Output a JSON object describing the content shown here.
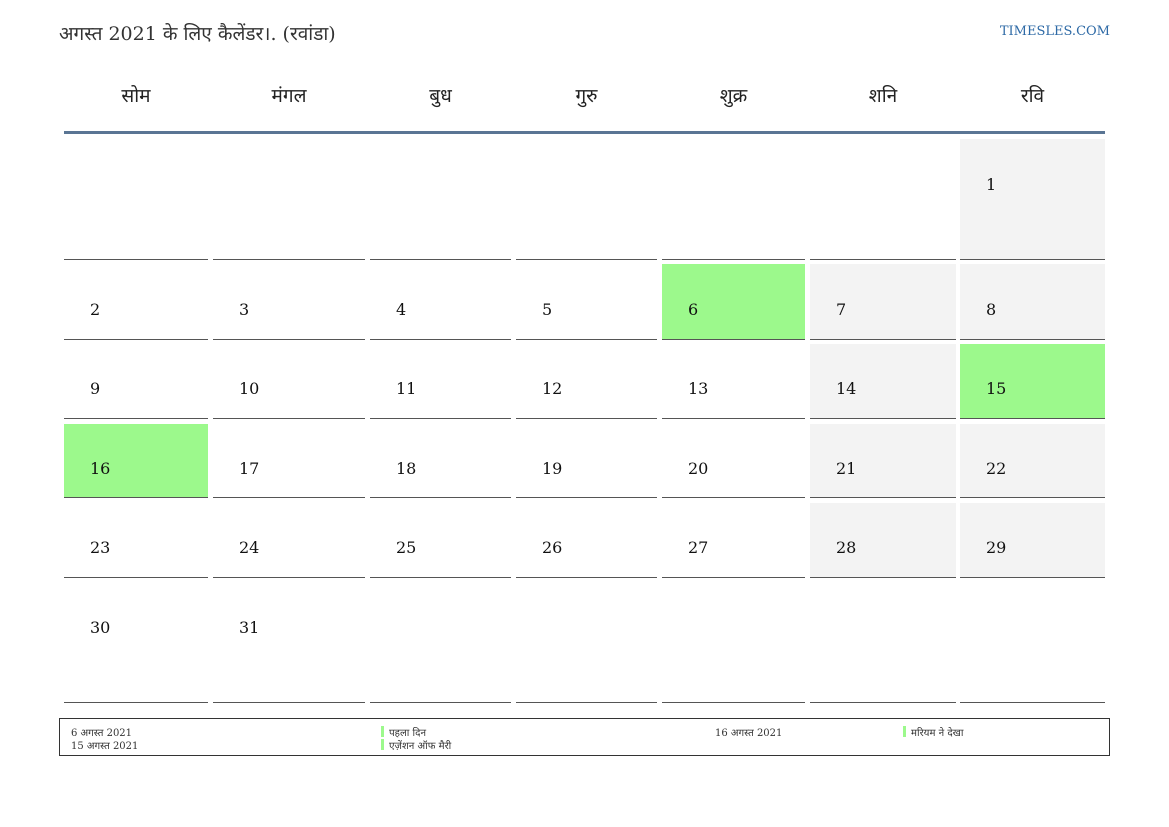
{
  "header": {
    "title": "अगस्त 2021 के लिए कैलेंडर।. (रवांडा)",
    "site": "TIMESLES.COM"
  },
  "weekdays": [
    "सोम",
    "मंगल",
    "बुध",
    "गुरु",
    "शुक्र",
    "शनि",
    "रवि"
  ],
  "weeks": [
    [
      "",
      "",
      "",
      "",
      "",
      "",
      "1"
    ],
    [
      "2",
      "3",
      "4",
      "5",
      "6",
      "7",
      "8"
    ],
    [
      "9",
      "10",
      "11",
      "12",
      "13",
      "14",
      "15"
    ],
    [
      "16",
      "17",
      "18",
      "19",
      "20",
      "21",
      "22"
    ],
    [
      "23",
      "24",
      "25",
      "26",
      "27",
      "28",
      "29"
    ],
    [
      "30",
      "31",
      "",
      "",
      "",
      "",
      ""
    ]
  ],
  "holidays": [
    "6",
    "15",
    "16"
  ],
  "colors": {
    "holiday": "#9cf98c",
    "weekend": "#f3f3f3",
    "header_rule": "#5a7594",
    "link": "#2e6aa6"
  },
  "legend": {
    "col1": {
      "date1": "6 अगस्त 2021",
      "date2": "15 अगस्त 2021"
    },
    "col2": {
      "name1": "पहला दिन",
      "name2": "एज़ेंशन ऑफ मैरी"
    },
    "col3": {
      "date1": "16 अगस्त 2021"
    },
    "col4": {
      "name1": "मरियम ने देखा"
    }
  }
}
